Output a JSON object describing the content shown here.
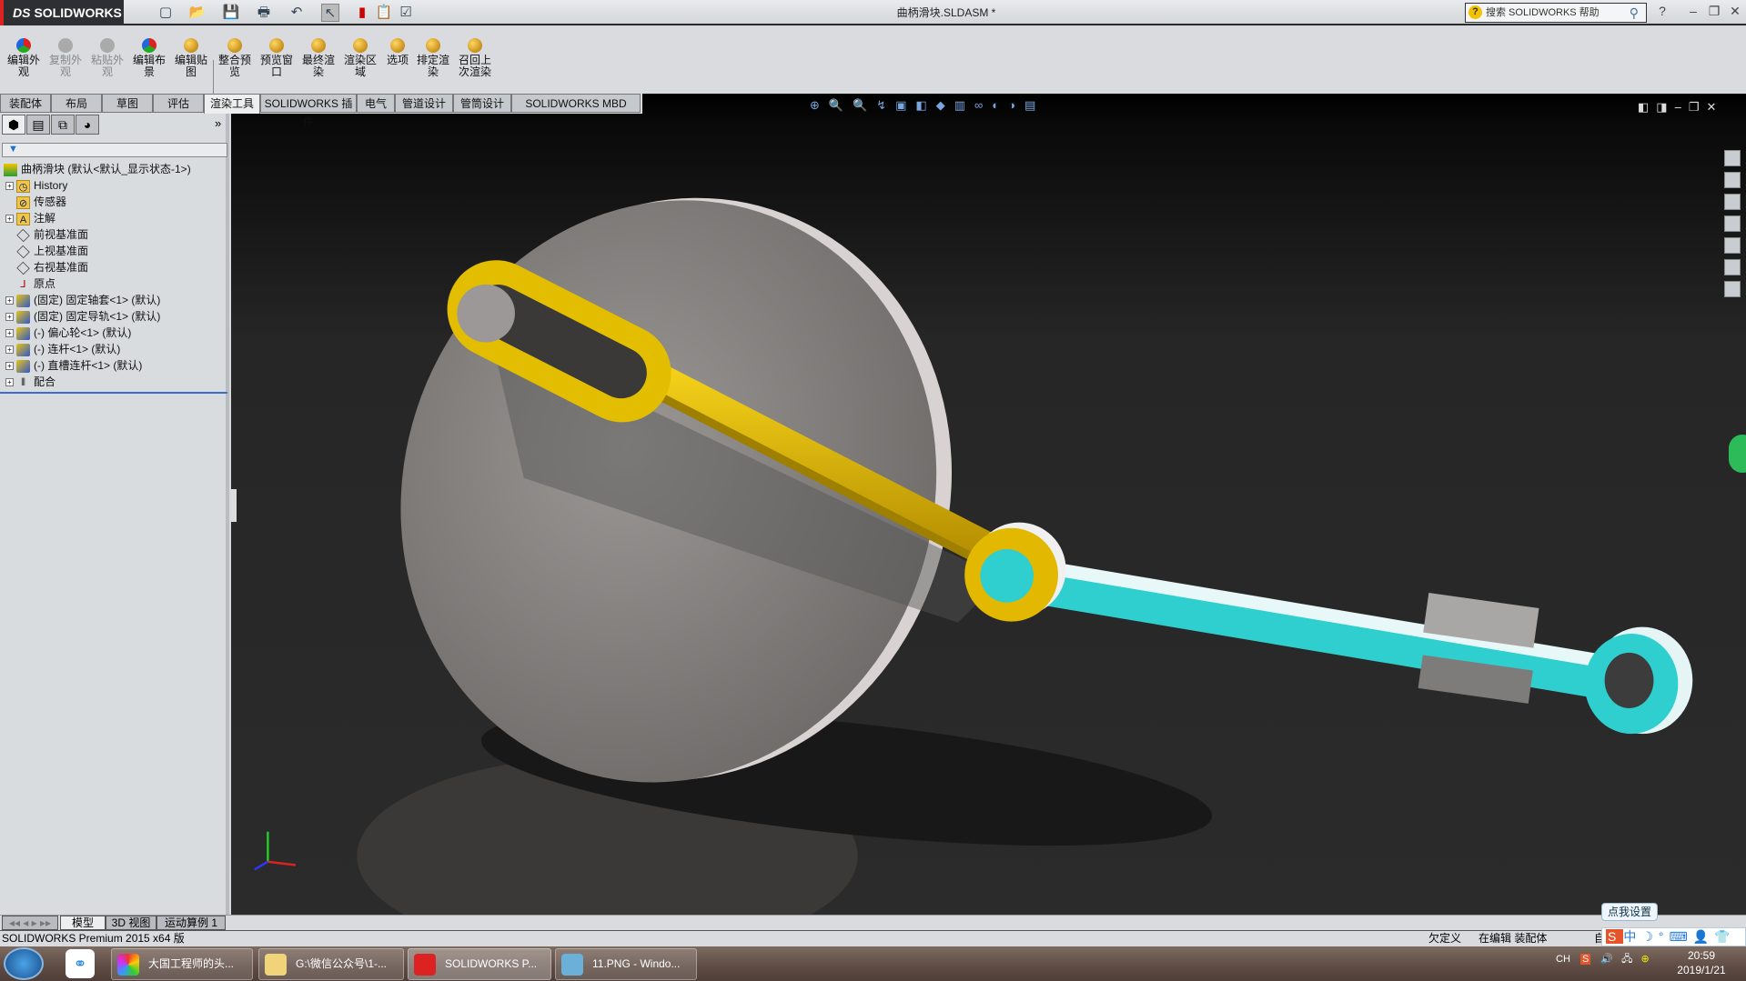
{
  "app": {
    "logo": "SOLIDWORKS",
    "title": "曲柄滑块.SLDASM *",
    "search_placeholder": "搜索 SOLIDWORKS 帮助"
  },
  "ribbon": [
    {
      "label": "编辑外观",
      "enabled": true
    },
    {
      "label": "复制外观",
      "enabled": false
    },
    {
      "label": "粘贴外观",
      "enabled": false
    },
    {
      "label": "编辑布景",
      "enabled": true
    },
    {
      "label": "编辑贴图",
      "enabled": true
    },
    {
      "label": "整合预览",
      "enabled": true
    },
    {
      "label": "预览窗口",
      "enabled": true
    },
    {
      "label": "最终渲染",
      "enabled": true
    },
    {
      "label": "渲染区域",
      "enabled": true
    },
    {
      "label": "选项",
      "enabled": true
    },
    {
      "label": "排定渲染",
      "enabled": true
    },
    {
      "label": "召回上次渲染",
      "enabled": true
    }
  ],
  "tabs": [
    "装配体",
    "布局",
    "草图",
    "评估",
    "渲染工具",
    "SOLIDWORKS 插件",
    "电气",
    "管道设计",
    "管筒设计",
    "SOLIDWORKS MBD"
  ],
  "active_tab": "渲染工具",
  "tree": {
    "root": "曲柄滑块  (默认<默认_显示状态-1>)",
    "items": [
      {
        "label": "History",
        "icon": "history-folder-icon",
        "expandable": true
      },
      {
        "label": "传感器",
        "icon": "sensor-folder-icon",
        "expandable": false
      },
      {
        "label": "注解",
        "icon": "annotation-folder-icon",
        "expandable": true
      },
      {
        "label": "前视基准面",
        "icon": "plane-icon",
        "expandable": false
      },
      {
        "label": "上视基准面",
        "icon": "plane-icon",
        "expandable": false
      },
      {
        "label": "右视基准面",
        "icon": "plane-icon",
        "expandable": false
      },
      {
        "label": "原点",
        "icon": "origin-icon",
        "expandable": false
      },
      {
        "label": "(固定) 固定轴套<1> (默认)",
        "icon": "part-icon",
        "expandable": true
      },
      {
        "label": "(固定) 固定导轨<1> (默认)",
        "icon": "part-icon",
        "expandable": true
      },
      {
        "label": "(-) 偏心轮<1> (默认)",
        "icon": "part-icon",
        "expandable": true
      },
      {
        "label": "(-) 连杆<1> (默认)",
        "icon": "part-icon",
        "expandable": true
      },
      {
        "label": "(-) 直槽连杆<1> (默认)",
        "icon": "part-icon",
        "expandable": true
      },
      {
        "label": "配合",
        "icon": "mates-icon",
        "expandable": true
      }
    ]
  },
  "bottom_tabs": [
    "模型",
    "3D 视图",
    "运动算例 1"
  ],
  "status": {
    "left": "SOLIDWORKS Premium 2015 x64 版",
    "state": "欠定义",
    "mode": "在编辑 装配体",
    "extra": "自"
  },
  "ime": {
    "tip": "点我设置",
    "mode": "中"
  },
  "taskbar": {
    "items": [
      "大国工程师的头...",
      "G:\\微信公众号\\1-...",
      "SOLIDWORKS P...",
      "11.PNG - Windo..."
    ],
    "lang": "CH",
    "time": "20:59",
    "date": "2019/1/21"
  },
  "colors": {
    "crank": "#e0b800",
    "link": "#2fcfcf",
    "disc": "#8d8a88",
    "viewport": "#2b2b2b"
  }
}
